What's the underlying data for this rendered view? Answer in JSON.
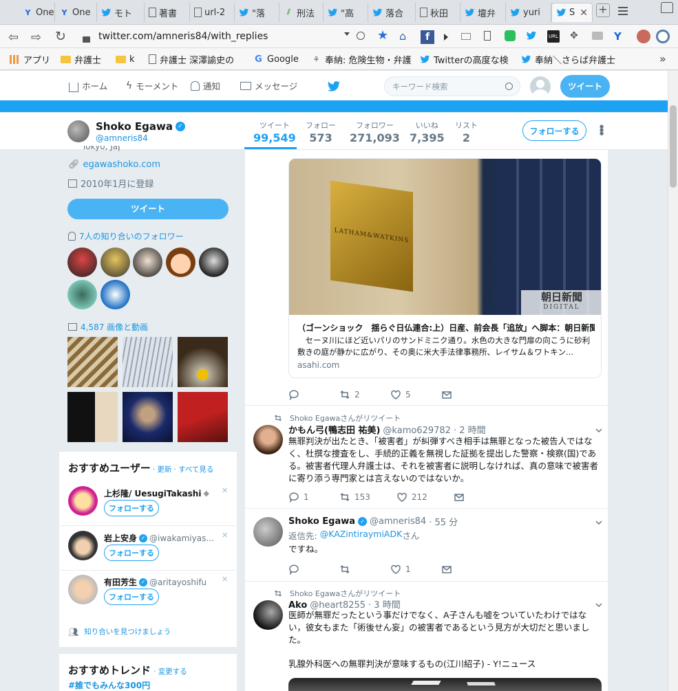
{
  "browser": {
    "tabs": [
      {
        "icon": "y-icon",
        "label": "One"
      },
      {
        "icon": "y-icon",
        "label": "One"
      },
      {
        "icon": "twitter-icon",
        "label": "モト"
      },
      {
        "icon": "doc-icon",
        "label": "著書"
      },
      {
        "icon": "doc-icon",
        "label": "url-2"
      },
      {
        "icon": "twitter-icon",
        "label": "\"落"
      },
      {
        "icon": "law-icon",
        "label": "刑法"
      },
      {
        "icon": "twitter-icon",
        "label": "\"高"
      },
      {
        "icon": "twitter-icon",
        "label": "落合"
      },
      {
        "icon": "doc-icon",
        "label": "秋田"
      },
      {
        "icon": "twitter-icon",
        "label": "壇弁"
      },
      {
        "icon": "twitter-icon",
        "label": "yuri"
      },
      {
        "icon": "twitter-icon",
        "label": "S"
      }
    ],
    "url": "twitter.com/amneris84/with_replies",
    "bookmarks": [
      {
        "icon": "apps-icon",
        "label": "アプリ"
      },
      {
        "icon": "folder-icon",
        "label": "弁護士"
      },
      {
        "icon": "folder-icon",
        "label": "k"
      },
      {
        "icon": "doc-icon",
        "label": "弁護士 深澤諭史の"
      },
      {
        "icon": "google-icon",
        "label": "Google"
      },
      {
        "icon": "bug-icon",
        "label": "奉納: 危険生物・弁護"
      },
      {
        "icon": "twitter-icon",
        "label": "Twitterの高度な検"
      },
      {
        "icon": "twitter-icon",
        "label": "奉納＼さらば弁護士"
      }
    ]
  },
  "nav": {
    "home": "ホーム",
    "moments": "モーメント",
    "notifications": "通知",
    "messages": "メッセージ",
    "search_placeholder": "キーワード検索",
    "tweet_button": "ツイート"
  },
  "profile": {
    "name": "Shoko Egawa",
    "handle": "@amneris84",
    "stats": [
      {
        "label": "ツイート",
        "value": "99,549"
      },
      {
        "label": "フォロー",
        "value": "573"
      },
      {
        "label": "フォロワー",
        "value": "271,093"
      },
      {
        "label": "いいね",
        "value": "7,395"
      },
      {
        "label": "リスト",
        "value": "2"
      }
    ],
    "follow_button": "フォローする",
    "location": "Tokyo, Japan",
    "website": "egawashoko.com",
    "joined": "2010年1月に登録",
    "tweet_button": "ツイート",
    "known_followers": "7人の知り合いのフォロワー",
    "media_link": "4,587 画像と動画"
  },
  "who_to_follow": {
    "title": "おすすめユーザー",
    "refresh": "· 更新",
    "view_all": "· すべて見る",
    "users": [
      {
        "name": "上杉隆/ UesugiTakashi",
        "handle": "",
        "follow": "フォローする"
      },
      {
        "name": "岩上安身",
        "handle": "@iwakamiyas...",
        "follow": "フォローする"
      },
      {
        "name": "有田芳生",
        "handle": "@aritayoshifu",
        "follow": "フォローする"
      }
    ],
    "find_friends": "知り合いを見つけましょう"
  },
  "trends": {
    "title": "おすすめトレンド",
    "change": "· 変更する",
    "first": "#誰でもみんな300円"
  },
  "tweets": {
    "card": {
      "image_caption": "朝日新聞",
      "image_caption2": "DIGITAL",
      "plate_text": "LATHAM&WATKINS",
      "title": "（ゴーンショック　揺らぐ日仏連合:上）日産、前会長「追放」へ脚本：朝日新聞...",
      "desc": "　セーヌ川にほど近いパリのサンドミニク通り。水色の大きな門扉の向こうに砂利敷きの庭が静かに広がり、その奥に米大手法律事務所、レイサム＆ワトキン...",
      "domain": "asahi.com",
      "retweets": "2",
      "likes": "5"
    },
    "t2": {
      "context": "Shoko Egawaさんがリツイート",
      "name": "かもん弓(鴨志田 祐美)",
      "handle": "@kamo629782",
      "time": "· 2 時間",
      "text": "無罪判決が出たとき、「被害者」が糾弾すべき相手は無罪となった被告人ではなく、杜撰な捜査をし、手続的正義を無視した証拠を提出した警察・検察(国)である。被害者代理人弁護士は、それを被害者に説明しなければ、真の意味で被害者に寄り添う専門家とは言えないのではないか。",
      "replies": "1",
      "retweets": "153",
      "likes": "212"
    },
    "t3": {
      "name": "Shoko Egawa",
      "handle": "@amneris84",
      "time": "· 55 分",
      "reply_to_label": "返信先:",
      "reply_to": "@KAZintiraymiADK",
      "reply_suffix": "さん",
      "text": "ですね。",
      "likes": "1"
    },
    "t4": {
      "context": "Shoko Egawaさんがリツイート",
      "name": "Ako",
      "handle": "@heart8255",
      "time": "· 3 時間",
      "text": "医師が無罪だったという事だけでなく、A子さんも嘘をついていたわけではない，彼女もまた「術後せん妄」の被害者であるという見方が大切だと思いました。",
      "text2": "乳腺外科医への無罪判決が意味するもの(江川紹子) - Y!ニュース"
    }
  }
}
